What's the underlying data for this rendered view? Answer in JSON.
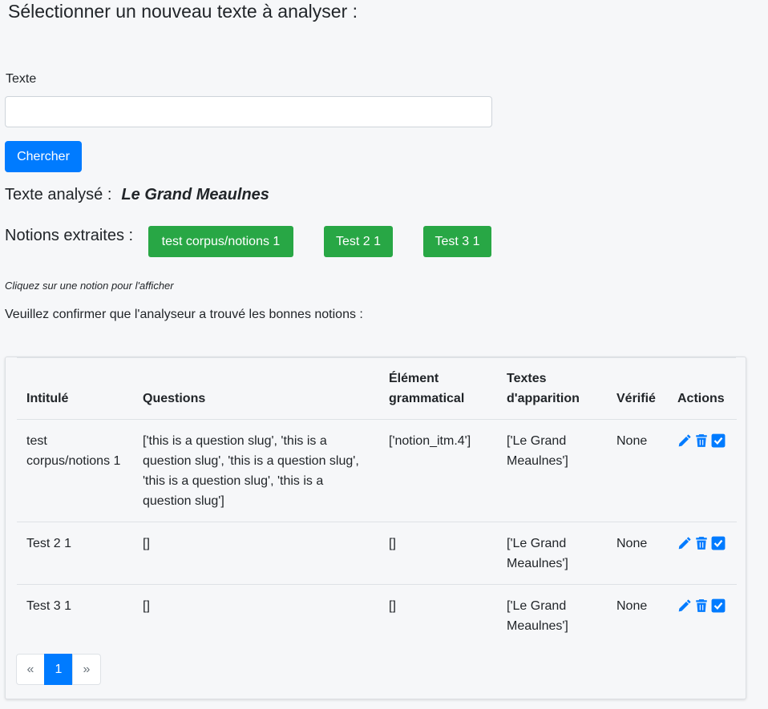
{
  "page": {
    "heading": "Sélectionner un nouveau texte à analyser :"
  },
  "search": {
    "label": "Texte",
    "value": "",
    "placeholder": "",
    "button_label": "Chercher"
  },
  "analysis": {
    "label": "Texte analysé :",
    "title": "Le Grand Meaulnes"
  },
  "notions": {
    "label": "Notions extraites :",
    "items": [
      "test corpus/notions 1",
      "Test 2 1",
      "Test 3 1"
    ],
    "hint": "Cliquez sur une notion pour l'afficher",
    "confirm_text": "Veuillez confirmer que l'analyseur a trouvé les bonnes notions :"
  },
  "table": {
    "headers": {
      "intitule": "Intitulé",
      "questions": "Questions",
      "element": "Élément grammatical",
      "textes": "Textes d'apparition",
      "verifie": "Vérifié",
      "actions": "Actions"
    },
    "rows": [
      {
        "intitule": "test corpus/notions 1",
        "questions": "['this is a question slug', 'this is a question slug', 'this is a question slug', 'this is a question slug', 'this is a question slug']",
        "element": "['notion_itm.4']",
        "textes": "['Le Grand Meaulnes']",
        "verifie": "None"
      },
      {
        "intitule": "Test 2 1",
        "questions": "[]",
        "element": "[]",
        "textes": "['Le Grand Meaulnes']",
        "verifie": "None"
      },
      {
        "intitule": "Test 3 1",
        "questions": "[]",
        "element": "[]",
        "textes": "['Le Grand Meaulnes']",
        "verifie": "None"
      }
    ],
    "action_icons": [
      "pencil-icon",
      "trash-icon",
      "checkbox-icon"
    ]
  },
  "pagination": {
    "prev": "«",
    "current": "1",
    "next": "»"
  },
  "colors": {
    "primary": "#007bff",
    "success": "#28a745",
    "background": "#f6f7f9"
  }
}
